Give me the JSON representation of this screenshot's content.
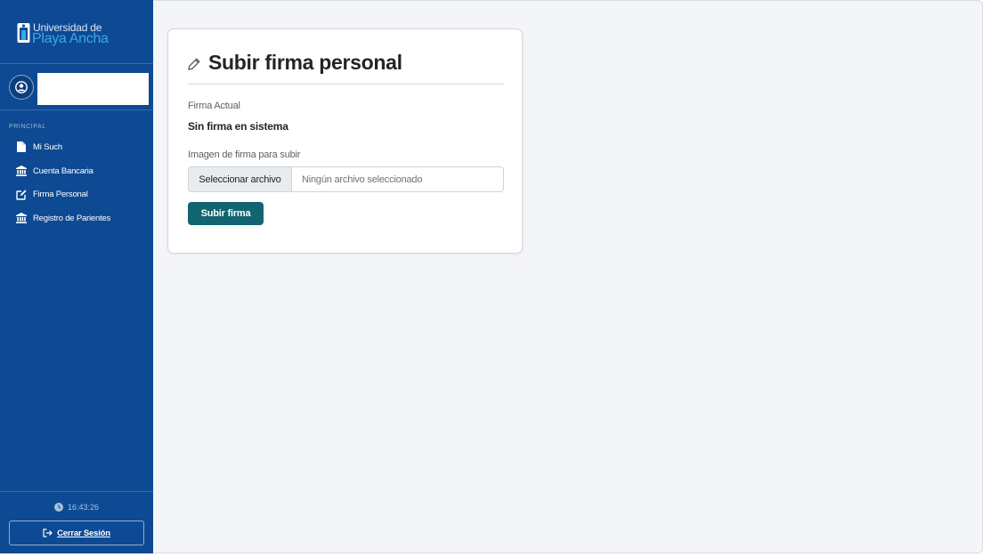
{
  "brand": {
    "line1": "Universidad de",
    "line2": "Playa Ancha"
  },
  "sidebar": {
    "section_label": "PRINCIPAL",
    "items": [
      {
        "label": "Mi Such",
        "icon": "document-icon"
      },
      {
        "label": "Cuenta Bancaria",
        "icon": "bank-icon"
      },
      {
        "label": "Firma Personal",
        "icon": "edit-icon"
      },
      {
        "label": "Registro de Parientes",
        "icon": "bank-icon"
      }
    ],
    "clock": "16:43:26",
    "logout_label": "Cerrar Sesión"
  },
  "card": {
    "title": "Subir firma personal",
    "current_label": "Firma Actual",
    "current_value": "Sin firma en sistema",
    "upload_label": "Imagen de firma para subir",
    "file_button_label": "Seleccionar archivo",
    "file_status": "Ningún archivo seleccionado",
    "submit_label": "Subir firma"
  },
  "colors": {
    "sidebar_bg": "#0d4a93",
    "accent_button": "#116570",
    "logo_accent": "#39a8e6",
    "main_bg": "#f4f5f9"
  }
}
